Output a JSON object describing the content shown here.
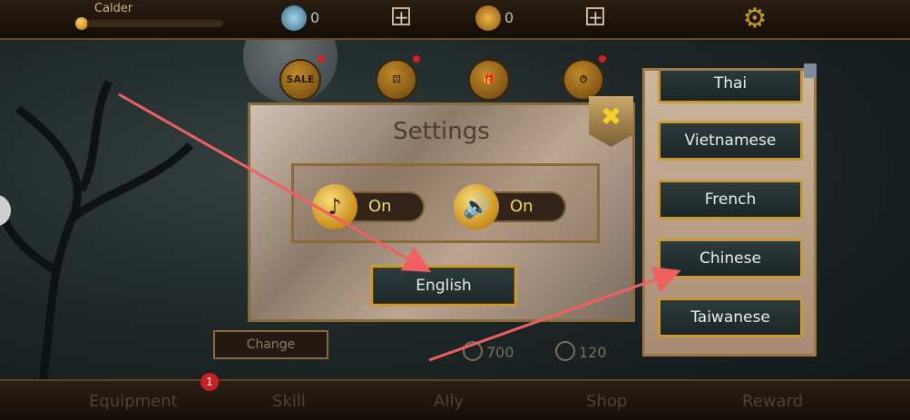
{
  "header": {
    "player_name": "Calder",
    "gems": "0",
    "coins": "0"
  },
  "settings": {
    "title": "Settings",
    "music": {
      "state": "On",
      "icon": "music-note-icon"
    },
    "sound": {
      "state": "On",
      "icon": "speaker-icon"
    },
    "language_button": "English",
    "close_icon": "close-icon"
  },
  "language_list": {
    "items": [
      "Thai",
      "Vietnamese",
      "French",
      "Chinese",
      "Taiwanese"
    ]
  },
  "bottom": {
    "change_label": "Change",
    "stat1": "700",
    "stat2": "120",
    "tabs": [
      "Equipment",
      "Skill",
      "Ally",
      "Shop",
      "Reward"
    ],
    "notification_count": "1"
  },
  "colors": {
    "accent_gold": "#c89a35",
    "toggle_text": "#f2d66b",
    "arrow": "#f06060"
  }
}
